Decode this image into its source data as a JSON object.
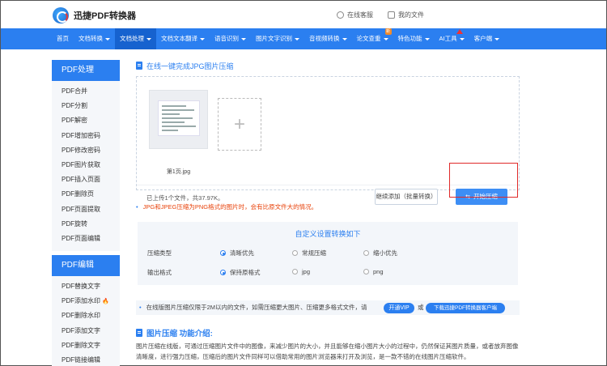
{
  "header": {
    "logo_text": "迅捷PDF转换器",
    "links": [
      "在线客服",
      "我的文件"
    ]
  },
  "nav": {
    "items": [
      {
        "label": "首页",
        "caret": false
      },
      {
        "label": "文档转换",
        "caret": true
      },
      {
        "label": "文档处理",
        "caret": true,
        "active": true
      },
      {
        "label": "文档文本翻译",
        "caret": true
      },
      {
        "label": "语音识别",
        "caret": true
      },
      {
        "label": "图片文字识别",
        "caret": true
      },
      {
        "label": "音视频转换",
        "caret": true
      },
      {
        "label": "论文查重",
        "caret": true,
        "badge": "新"
      },
      {
        "label": "特色功能",
        "caret": true
      },
      {
        "label": "AI工具",
        "caret": true,
        "hot": true
      },
      {
        "label": "客户端",
        "caret": true
      }
    ]
  },
  "sidebar": {
    "group1_title": "PDF处理",
    "group1_items": [
      "PDF合并",
      "PDF分割",
      "PDF解密",
      "PDF增加密码",
      "PDF修改密码",
      "PDF图片获取",
      "PDF插入页面",
      "PDF删除页",
      "PDF页面提取",
      "PDF旋转",
      "PDF页面编辑"
    ],
    "group2_title": "PDF编辑",
    "group2_items": [
      "PDF替换文字",
      "PDF添加水印",
      "PDF删除水印",
      "PDF添加文字",
      "PDF删除文字",
      "PDF链接编辑"
    ],
    "fire_icon": "🔥"
  },
  "main": {
    "title": "在线一键完成JPG图片压缩",
    "thumb_name": "第1页.jpg",
    "status_text": "已上传1个文件，共37.97K。",
    "btn_more": "继续添加（批量转换）",
    "btn_start": "开始压缩",
    "note1": "JPG和JPEG压缩为PNG格式的图片时，会有比原文件大的情况。",
    "settings": {
      "title": "自定义设置转换如下",
      "row1_label": "压缩类型",
      "row1_options": [
        "清晰优先",
        "常规压缩",
        "缩小优先"
      ],
      "row2_label": "输出格式",
      "row2_options": [
        "保持原格式",
        "jpg",
        "png"
      ]
    },
    "note2": "在线版图片压缩仅限于2M以内的文件，如需压缩更大图片、压缩更多格式文件，请",
    "btn_vip": "开通VIP",
    "or_text": "或",
    "btn_download": "下载迅捷PDF转换器客户端",
    "intro_title": "图片压缩 功能介绍:",
    "intro_text": "图片压缩在线版，可通过压缩图片文件中的图像，来减少图片的大小，并且能够在缩小图片大小的过程中，仍然保证其图片质量，或者放弃图像清晰度，进行强力压缩，压缩后的图片文件同样可以借助常用的图片浏览器来打开及浏览，是一款不错的在线图片压缩软件。"
  },
  "colors": {
    "primary": "#2b7ff0",
    "highlight": "#e02a2a",
    "warning": "#e8420a"
  }
}
